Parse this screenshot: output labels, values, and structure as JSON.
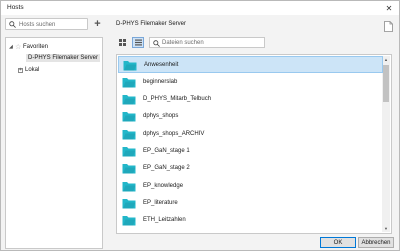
{
  "window": {
    "title": "Hosts",
    "close_label": "✕"
  },
  "left": {
    "search_placeholder": "Hosts suchen",
    "add_label": "+",
    "tree": {
      "favorites_label": "Favoriten",
      "favorite_item": "D-PHYS Filemaker Server",
      "local_label": "Lokal"
    }
  },
  "right": {
    "server_title": "D-PHYS Filemaker Server",
    "search_placeholder": "Dateien suchen",
    "folder_color": "#23b7c9",
    "selected_row": 0,
    "files": [
      "Anwesenheit",
      "beginnerslab",
      "D_PHYS_Mitarb_Telbuch",
      "dphys_shops",
      "dphys_shops_ARCHIV",
      "EP_GaN_stage 1",
      "EP_GaN_stage 2",
      "EP_knowledge",
      "EP_literature",
      "ETH_Leitzahlen"
    ]
  },
  "buttons": {
    "ok": "OK",
    "cancel": "Abbrechen"
  }
}
